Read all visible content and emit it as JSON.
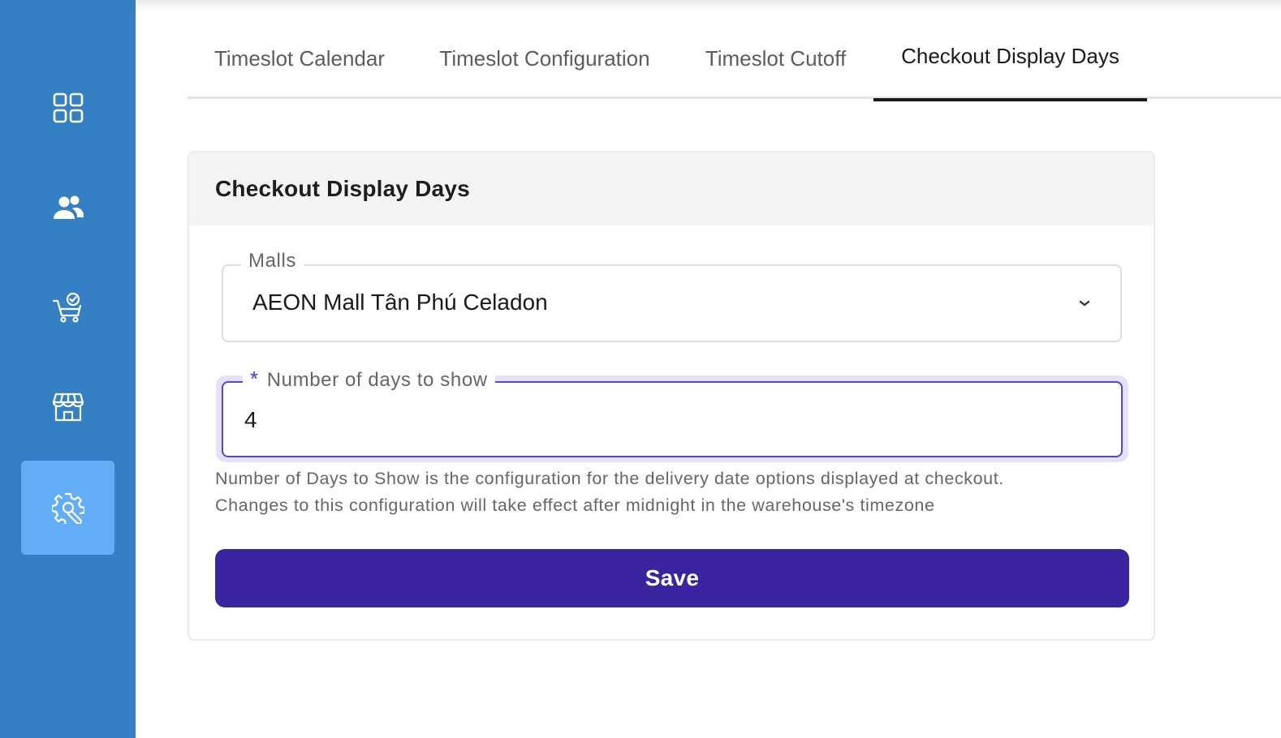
{
  "sidebar": {
    "items": [
      {
        "icon": "dashboard-grid-icon",
        "active": false
      },
      {
        "icon": "users-icon",
        "active": false
      },
      {
        "icon": "cart-check-icon",
        "active": false
      },
      {
        "icon": "store-icon",
        "active": false
      },
      {
        "icon": "settings-tools-icon",
        "active": true
      }
    ],
    "colors": {
      "background": "#3580c4",
      "active": "#62adf5"
    }
  },
  "tabs": [
    {
      "label": "Timeslot Calendar",
      "active": false
    },
    {
      "label": "Timeslot Configuration",
      "active": false
    },
    {
      "label": "Timeslot Cutoff",
      "active": false
    },
    {
      "label": "Checkout Display Days",
      "active": true
    }
  ],
  "card": {
    "title": "Checkout Display Days",
    "malls": {
      "label": "Malls",
      "value": "AEON Mall Tân Phú Celadon"
    },
    "days": {
      "required_mark": "*",
      "label": "Number of days to show",
      "value": "4"
    },
    "help_line1": "Number of Days to Show is the configuration for the delivery date options displayed at checkout.",
    "help_line2": "Changes to this configuration will take effect after midnight in the warehouse's timezone",
    "save_label": "Save"
  },
  "colors": {
    "primary_button": "#3b249f",
    "focus_border": "#5848cf",
    "focus_ring": "#e6e1f9"
  }
}
